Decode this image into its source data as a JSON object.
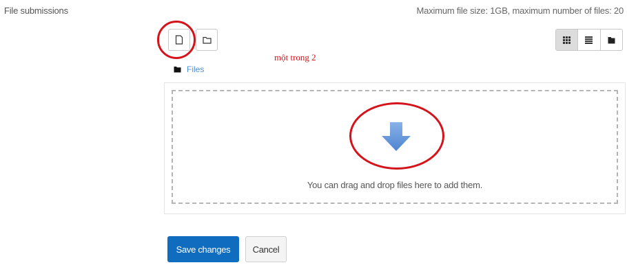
{
  "form": {
    "field_label": "File submissions",
    "limits_text": "Maximum file size: 1GB, maximum number of files: 20"
  },
  "toolbar": {
    "add_file_icon": "file-icon",
    "create_folder_icon": "folder-icon",
    "view_modes": [
      {
        "icon": "grid-icon",
        "active": true
      },
      {
        "icon": "list-icon",
        "active": false
      },
      {
        "icon": "tree-icon",
        "active": false
      }
    ]
  },
  "annotation": {
    "text": "một trong 2",
    "color": "#d4131b"
  },
  "path": {
    "icon": "folder-icon",
    "label": "Files"
  },
  "dropzone": {
    "icon": "down-arrow-icon",
    "message": "You can drag and drop files here to add them."
  },
  "buttons": {
    "save_label": "Save changes",
    "cancel_label": "Cancel"
  },
  "colors": {
    "primary": "#0f6cbf",
    "annotation_red": "#d4131b",
    "link": "#4a90d9",
    "arrow": "#6f9fdd"
  }
}
